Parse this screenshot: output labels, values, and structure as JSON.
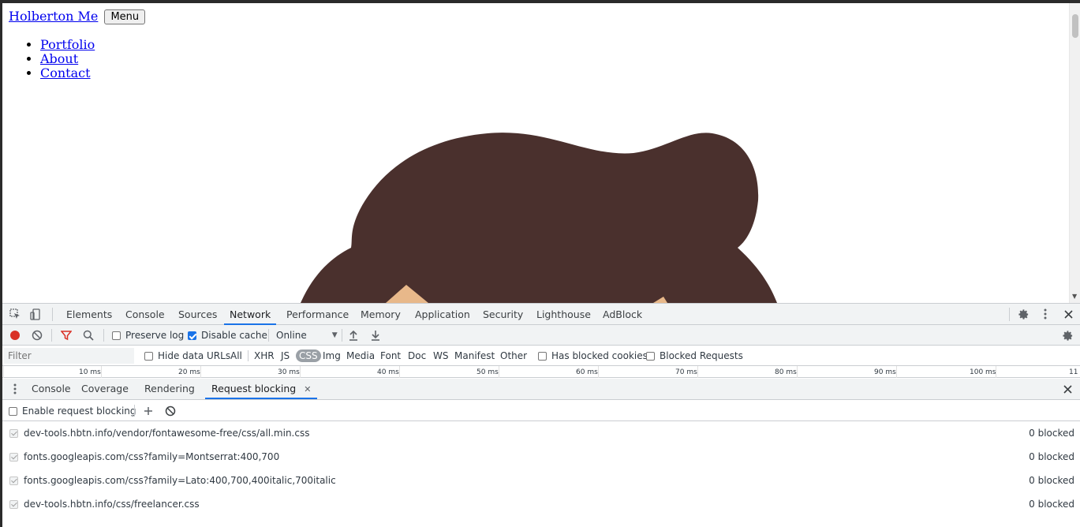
{
  "page": {
    "site_link": "Holberton Me",
    "menu_button": "Menu",
    "nav": [
      "Portfolio",
      "About",
      "Contact"
    ]
  },
  "devtools": {
    "tabs": [
      "Elements",
      "Console",
      "Sources",
      "Network",
      "Performance",
      "Memory",
      "Application",
      "Security",
      "Lighthouse",
      "AdBlock"
    ],
    "active_tab": "Network",
    "toolbar": {
      "preserve_log": "Preserve log",
      "preserve_log_checked": false,
      "disable_cache": "Disable cache",
      "disable_cache_checked": true,
      "throttling": "Online"
    },
    "filter": {
      "placeholder": "Filter",
      "hide_data_urls": "Hide data URLs",
      "types": [
        "All",
        "XHR",
        "JS",
        "CSS",
        "Img",
        "Media",
        "Font",
        "Doc",
        "WS",
        "Manifest",
        "Other"
      ],
      "active_type": "CSS",
      "has_blocked_cookies": "Has blocked cookies",
      "blocked_requests": "Blocked Requests"
    },
    "timeline_ticks": [
      "10 ms",
      "20 ms",
      "30 ms",
      "40 ms",
      "50 ms",
      "60 ms",
      "70 ms",
      "80 ms",
      "90 ms",
      "100 ms",
      "11"
    ],
    "drawer_tabs": [
      "Console",
      "Coverage",
      "Rendering",
      "Request blocking"
    ],
    "active_drawer_tab": "Request blocking",
    "request_blocking": {
      "enable_label": "Enable request blocking",
      "enabled": false,
      "patterns": [
        {
          "url": "dev-tools.hbtn.info/vendor/fontawesome-free/css/all.min.css",
          "status": "0 blocked"
        },
        {
          "url": "fonts.googleapis.com/css?family=Montserrat:400,700",
          "status": "0 blocked"
        },
        {
          "url": "fonts.googleapis.com/css?family=Lato:400,700,400italic,700italic",
          "status": "0 blocked"
        },
        {
          "url": "dev-tools.hbtn.info/css/freelancer.css",
          "status": "0 blocked"
        }
      ]
    }
  },
  "colors": {
    "hair": "#4a302d",
    "skin": "#e8b88a",
    "accent": "#1a73e8",
    "record": "#d93025",
    "filter_icon": "#d93025"
  },
  "icons": [
    "inspect-icon",
    "device-toolbar-icon",
    "settings-icon",
    "more-vert-icon",
    "close-icon",
    "record-icon",
    "clear-icon",
    "filter-icon",
    "search-icon",
    "import-icon",
    "export-icon",
    "add-icon",
    "block-icon"
  ]
}
